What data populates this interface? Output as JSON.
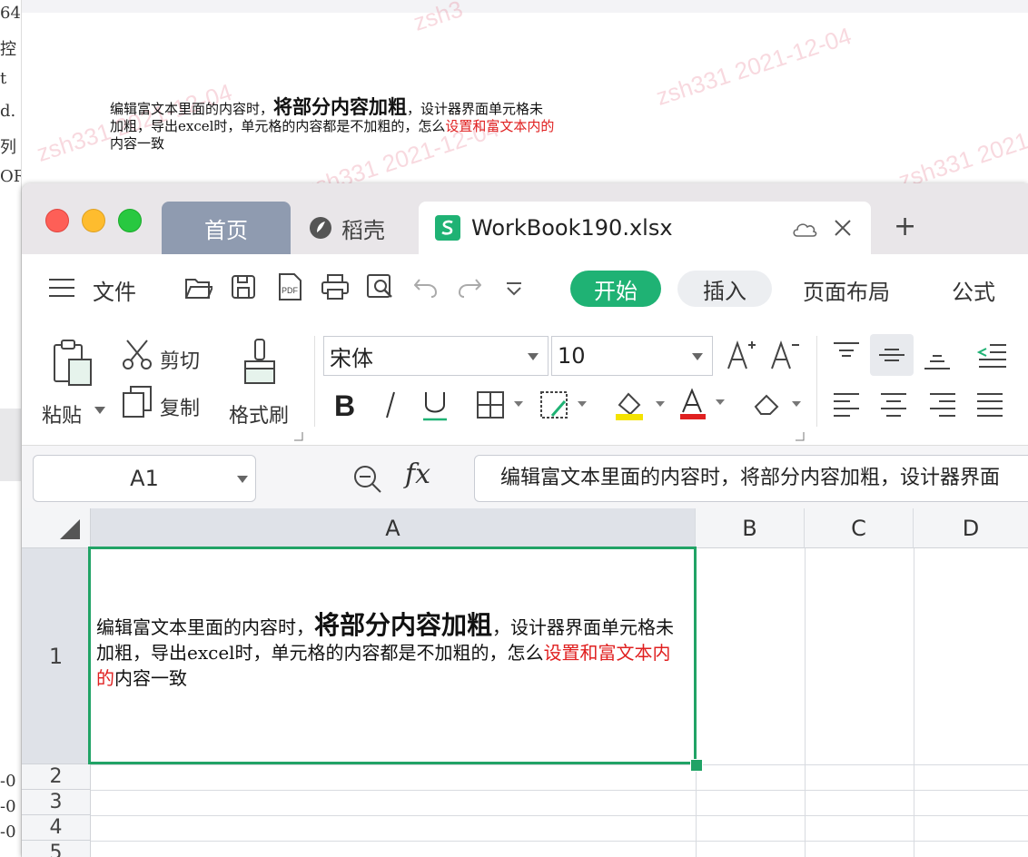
{
  "background": {
    "left_strip_chars": [
      "64(",
      "控",
      "t",
      "d.",
      "列",
      "OR"
    ],
    "left_strip_lower": [
      "-0",
      "-0",
      "-0"
    ],
    "watermarks": [
      "zsh331 2021-12-04",
      "zsh331 2021-12-04",
      "zsh331 2021-12-04",
      "zsh331 2021-12-04",
      "zsh3"
    ],
    "note": {
      "part1": "编辑富文本里面的内容时，",
      "bold": "将部分内容加粗",
      "part2": "，设计器界面单元格未加粗，导出excel时，单元格的内容都是不加粗的，怎么",
      "red": "设置和富文本内的",
      "part3": "内容一致"
    }
  },
  "window": {
    "tabs": {
      "home": "首页",
      "daoke": "稻壳",
      "workbook": "WorkBook190.xlsx",
      "new_tab": "+"
    },
    "menu": {
      "file": "文件",
      "start": "开始",
      "insert": "插入",
      "page_layout": "页面布局",
      "formula": "公式"
    },
    "ribbon": {
      "paste": "粘贴",
      "cut": "剪切",
      "copy": "复制",
      "format_painter": "格式刷",
      "font_name": "宋体",
      "font_size": "10"
    },
    "formula_bar": {
      "cell_ref": "A1",
      "fx": "fx",
      "content": "编辑富文本里面的内容时，将部分内容加粗，设计器界面"
    },
    "sheet": {
      "columns": [
        "A",
        "B",
        "C",
        "D"
      ],
      "rows": [
        "1",
        "2",
        "3",
        "4",
        "5"
      ],
      "cell_a1": {
        "part1": "编辑富文本里面的内容时，",
        "bold": "将部分内容加粗",
        "part2": "，设计器界面单元格未加粗，导出excel时，单元格的内容都是不加粗的，怎么",
        "red": "设置和富文本内的",
        "part3": "内容一致"
      }
    },
    "colors": {
      "accent_green": "#1fb274",
      "selection_green": "#21a366",
      "home_tab": "#8f9bb0",
      "red_text": "#e02020"
    }
  }
}
